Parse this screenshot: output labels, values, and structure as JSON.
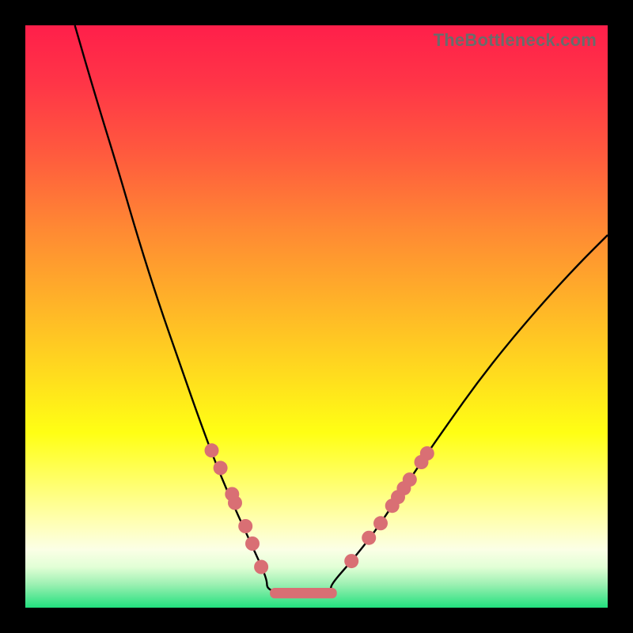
{
  "watermark": "TheBottleneck.com",
  "colors": {
    "frame": "#000000",
    "curve": "#000000",
    "point": "#d96f74",
    "gradient_stops": [
      {
        "offset": 0.0,
        "color": "#ff1f4a"
      },
      {
        "offset": 0.1,
        "color": "#ff3547"
      },
      {
        "offset": 0.22,
        "color": "#ff5a3e"
      },
      {
        "offset": 0.35,
        "color": "#ff8933"
      },
      {
        "offset": 0.48,
        "color": "#ffb428"
      },
      {
        "offset": 0.6,
        "color": "#ffdc1e"
      },
      {
        "offset": 0.7,
        "color": "#ffff14"
      },
      {
        "offset": 0.78,
        "color": "#ffff66"
      },
      {
        "offset": 0.85,
        "color": "#ffffb0"
      },
      {
        "offset": 0.9,
        "color": "#fbffe6"
      },
      {
        "offset": 0.93,
        "color": "#e2ffd6"
      },
      {
        "offset": 0.96,
        "color": "#9cf0b2"
      },
      {
        "offset": 1.0,
        "color": "#22e07e"
      }
    ]
  },
  "chart_data": {
    "type": "line",
    "title": "",
    "xlabel": "",
    "ylabel": "",
    "x_range_units": "relative (0-1 across plot width)",
    "y_range_units": "relative (0 at top, 1 at bottom of plot)",
    "note": "No axis ticks or numeric labels are visible; values are normalized positions read from the figure.",
    "series": [
      {
        "name": "left-branch",
        "x": [
          0.085,
          0.12,
          0.16,
          0.195,
          0.23,
          0.265,
          0.3,
          0.33,
          0.36,
          0.39,
          0.415
        ],
        "y": [
          0.0,
          0.12,
          0.25,
          0.37,
          0.48,
          0.58,
          0.68,
          0.76,
          0.83,
          0.895,
          0.95
        ]
      },
      {
        "name": "flat-minimum",
        "x": [
          0.415,
          0.45,
          0.49,
          0.525
        ],
        "y": [
          0.97,
          0.975,
          0.975,
          0.97
        ]
      },
      {
        "name": "right-branch",
        "x": [
          0.525,
          0.56,
          0.6,
          0.64,
          0.68,
          0.725,
          0.775,
          0.83,
          0.89,
          0.95,
          1.0
        ],
        "y": [
          0.96,
          0.92,
          0.87,
          0.81,
          0.75,
          0.685,
          0.615,
          0.545,
          0.475,
          0.41,
          0.36
        ]
      }
    ],
    "points": [
      {
        "x": 0.32,
        "y": 0.73
      },
      {
        "x": 0.335,
        "y": 0.76
      },
      {
        "x": 0.355,
        "y": 0.805
      },
      {
        "x": 0.36,
        "y": 0.82
      },
      {
        "x": 0.378,
        "y": 0.86
      },
      {
        "x": 0.39,
        "y": 0.89
      },
      {
        "x": 0.405,
        "y": 0.93
      },
      {
        "x": 0.56,
        "y": 0.92
      },
      {
        "x": 0.59,
        "y": 0.88
      },
      {
        "x": 0.61,
        "y": 0.855
      },
      {
        "x": 0.63,
        "y": 0.825
      },
      {
        "x": 0.64,
        "y": 0.81
      },
      {
        "x": 0.65,
        "y": 0.795
      },
      {
        "x": 0.66,
        "y": 0.78
      },
      {
        "x": 0.68,
        "y": 0.75
      },
      {
        "x": 0.69,
        "y": 0.735
      }
    ],
    "flat_segment": {
      "x0": 0.42,
      "x1": 0.535,
      "y": 0.975,
      "thickness_rel": 0.018
    }
  }
}
